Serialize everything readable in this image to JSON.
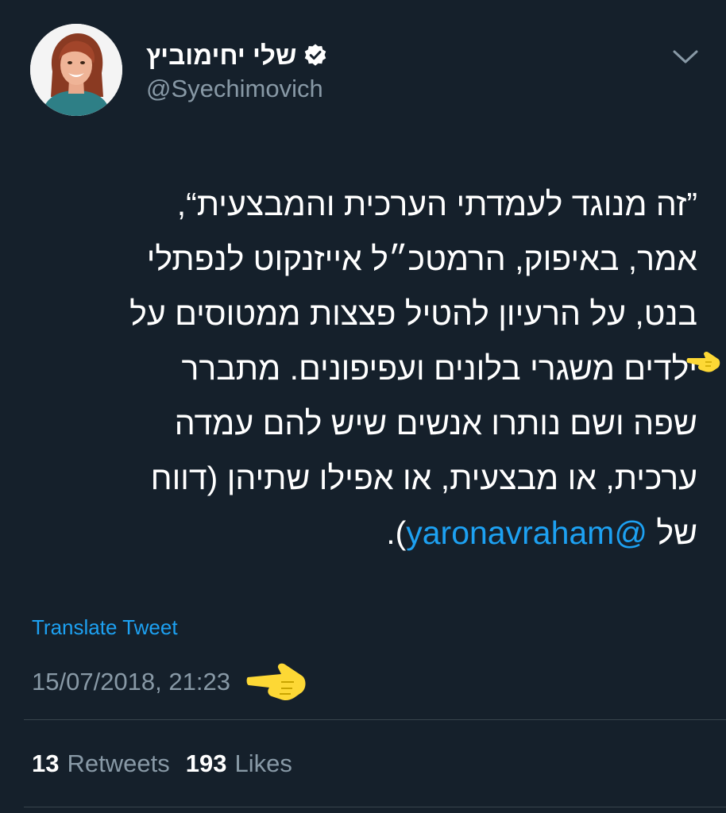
{
  "tweet": {
    "author": {
      "display_name": "שלי יחימוביץ",
      "handle": "@Syechimovich",
      "verified_icon": "verified-badge-icon",
      "avatar_icon": "avatar"
    },
    "more_icon": "chevron-down-icon",
    "text_lines": [
      "”זה מנוגד לעמדתי הערכית והמבצעית“,",
      "אמר, באיפוק, הרמטכ״ל אייזנקוט לנפתלי",
      "בנט, על הרעיון להטיל פצצות ממטוסים על",
      "ילדים משגרי בלונים ועפיפונים. מתברר",
      "שפה ושם נותרו אנשים שיש להם עמדה",
      "ערכית, או מבצעית, או אפילו שתיהן (דווח"
    ],
    "last_line": {
      "prefix": "של ",
      "mention": "@yaronavraham",
      "suffix": ")."
    },
    "translate_label": "Translate Tweet",
    "timestamp": "15/07/2018, 21:23",
    "stats": {
      "retweets_count": "13",
      "retweets_label": "Retweets",
      "likes_count": "193",
      "likes_label": "Likes"
    }
  },
  "annotations": {
    "pointer_icon": "pointing-hand-icon"
  },
  "colors": {
    "background": "#15202b",
    "text": "#ffffff",
    "secondary_text": "#8899a6",
    "link": "#1da1f2",
    "divider": "#38444d",
    "annotation": "#fdd835"
  }
}
